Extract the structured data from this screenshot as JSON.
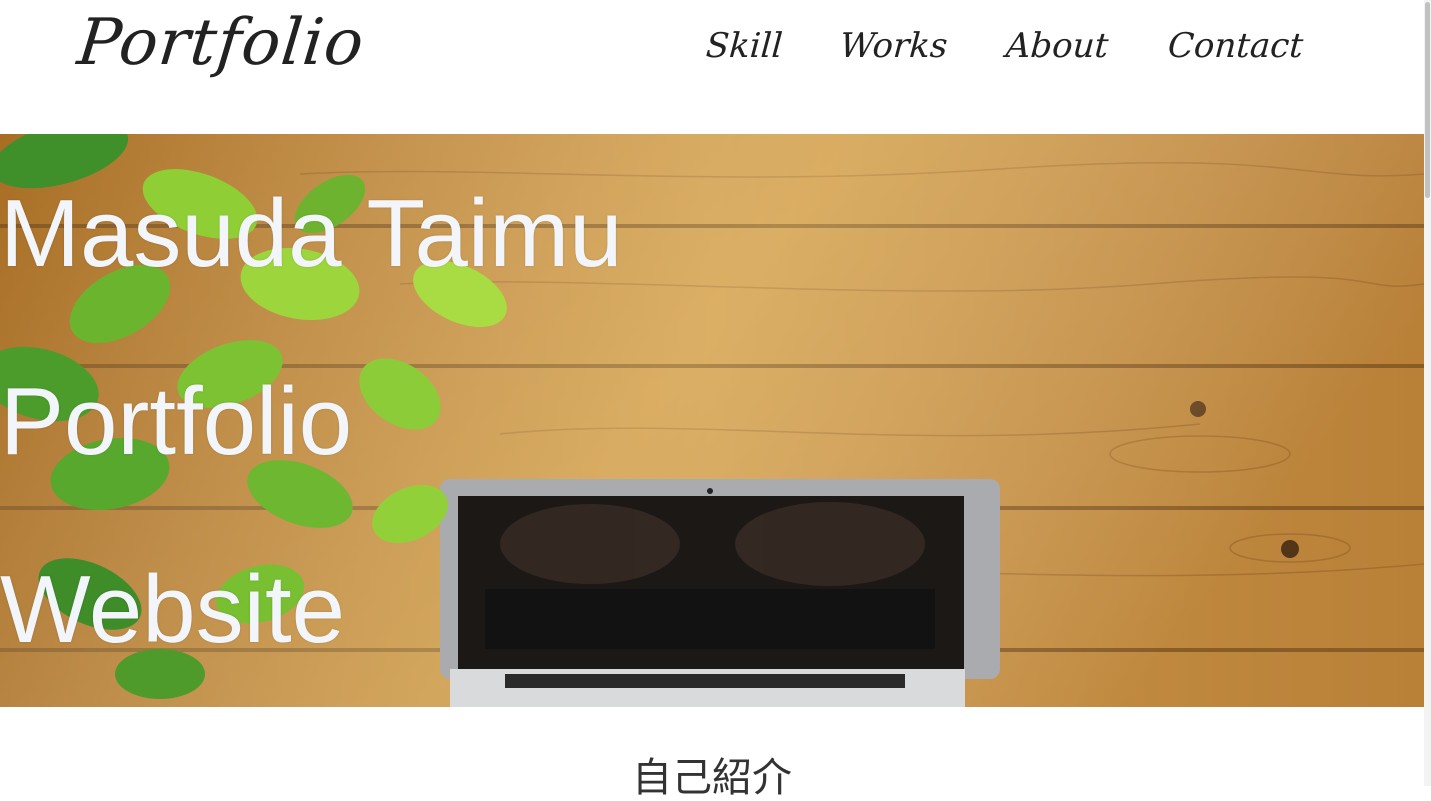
{
  "header": {
    "logo": "Portfolio",
    "nav": [
      {
        "label": "Skill"
      },
      {
        "label": "Works"
      },
      {
        "label": "About"
      },
      {
        "label": "Contact"
      }
    ]
  },
  "hero": {
    "lines": [
      "Masuda Taimu",
      "Portfolio",
      "Website"
    ],
    "background_icon": "laptop-on-wooden-desk-photo"
  },
  "section": {
    "title": "自己紹介"
  },
  "colors": {
    "hero_text": "#f2f5fa",
    "header_text": "#222222",
    "wood": "#b87e2c"
  }
}
